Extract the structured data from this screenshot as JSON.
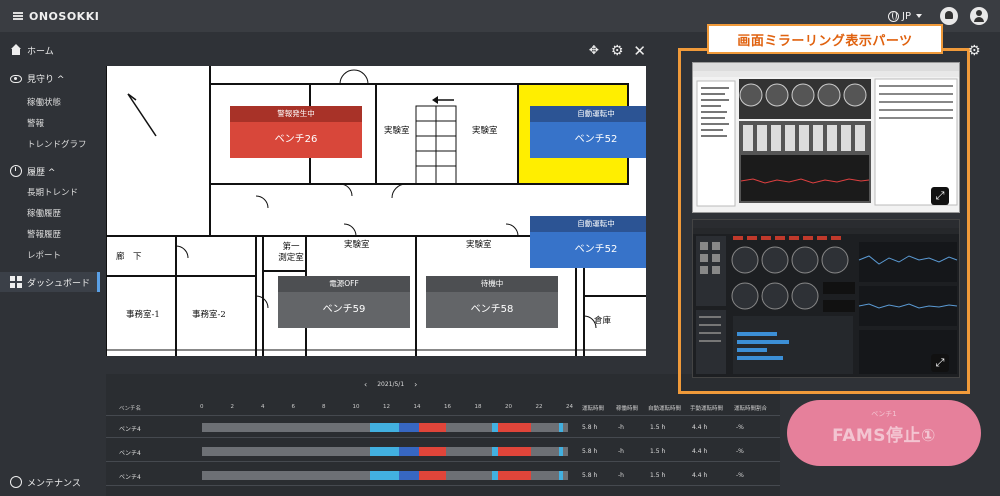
{
  "app": {
    "brand": "ONOSOKKI"
  },
  "topbar": {
    "lang": "JP"
  },
  "sidebar": {
    "home": "ホーム",
    "monitor": {
      "label": "見守り ^",
      "items": [
        "稼働状態",
        "警報",
        "トレンドグラフ"
      ]
    },
    "history": {
      "label": "履歴 ^",
      "items": [
        "長期トレンド",
        "稼働履歴",
        "警報履歴",
        "レポート"
      ]
    },
    "dashboard": "ダッシュボード",
    "maintenance": "メンテナンス"
  },
  "floorplan": {
    "rooms": {
      "lab": "実験室",
      "corridor": "廊　下",
      "measure": "第一\n測定室",
      "office1": "事務室-1",
      "office2": "事務室-2",
      "warehouse": "倉庫"
    },
    "benches": [
      {
        "status": "警報発生中",
        "name": "ベンチ26",
        "head_color": "#a83228",
        "body_color": "#d8473a"
      },
      {
        "status": "自動運転中",
        "name": "ベンチ52",
        "head_color": "#2c5494",
        "body_color": "#3773c9"
      },
      {
        "status": "自動運転中",
        "name": "ベンチ52",
        "head_color": "#2c5494",
        "body_color": "#3773c9"
      },
      {
        "status": "電源OFF",
        "name": "ベンチ59",
        "head_color": "#4d4f52",
        "body_color": "#636568"
      },
      {
        "status": "待機中",
        "name": "ベンチ58",
        "head_color": "#4d4f52",
        "body_color": "#636568"
      }
    ]
  },
  "timeline": {
    "date": "2021/5/1",
    "prev": "‹",
    "next": "›",
    "columns": {
      "bench": "ベンチ名",
      "run": "運転時間",
      "operate": "稼働時間",
      "auto": "自動運転時間",
      "manual": "手動運転時間",
      "rate": "運転時間割合"
    },
    "hours": [
      "0",
      "2",
      "4",
      "6",
      "8",
      "10",
      "12",
      "14",
      "16",
      "18",
      "20",
      "22",
      "24"
    ],
    "rows": [
      {
        "name": "ベンチ4",
        "run": "5.8 h",
        "operate": "-h",
        "auto": "1.5 h",
        "manual": "4.4 h",
        "rate": "-%"
      },
      {
        "name": "ベンチ4",
        "run": "5.8 h",
        "operate": "-h",
        "auto": "1.5 h",
        "manual": "4.4 h",
        "rate": "-%"
      },
      {
        "name": "ベンチ4",
        "run": "5.8 h",
        "operate": "-h",
        "auto": "1.5 h",
        "manual": "4.4 h",
        "rate": "-%"
      }
    ]
  },
  "mirror": {
    "title": "画面ミラーリング表示パーツ"
  },
  "fams": {
    "small": "ベンチ1",
    "big": "FAMS停止①"
  },
  "colors": {
    "accent": "#f09a3a",
    "alarm": "#d8473a",
    "auto": "#3773c9",
    "highlight": "#ffee00"
  }
}
